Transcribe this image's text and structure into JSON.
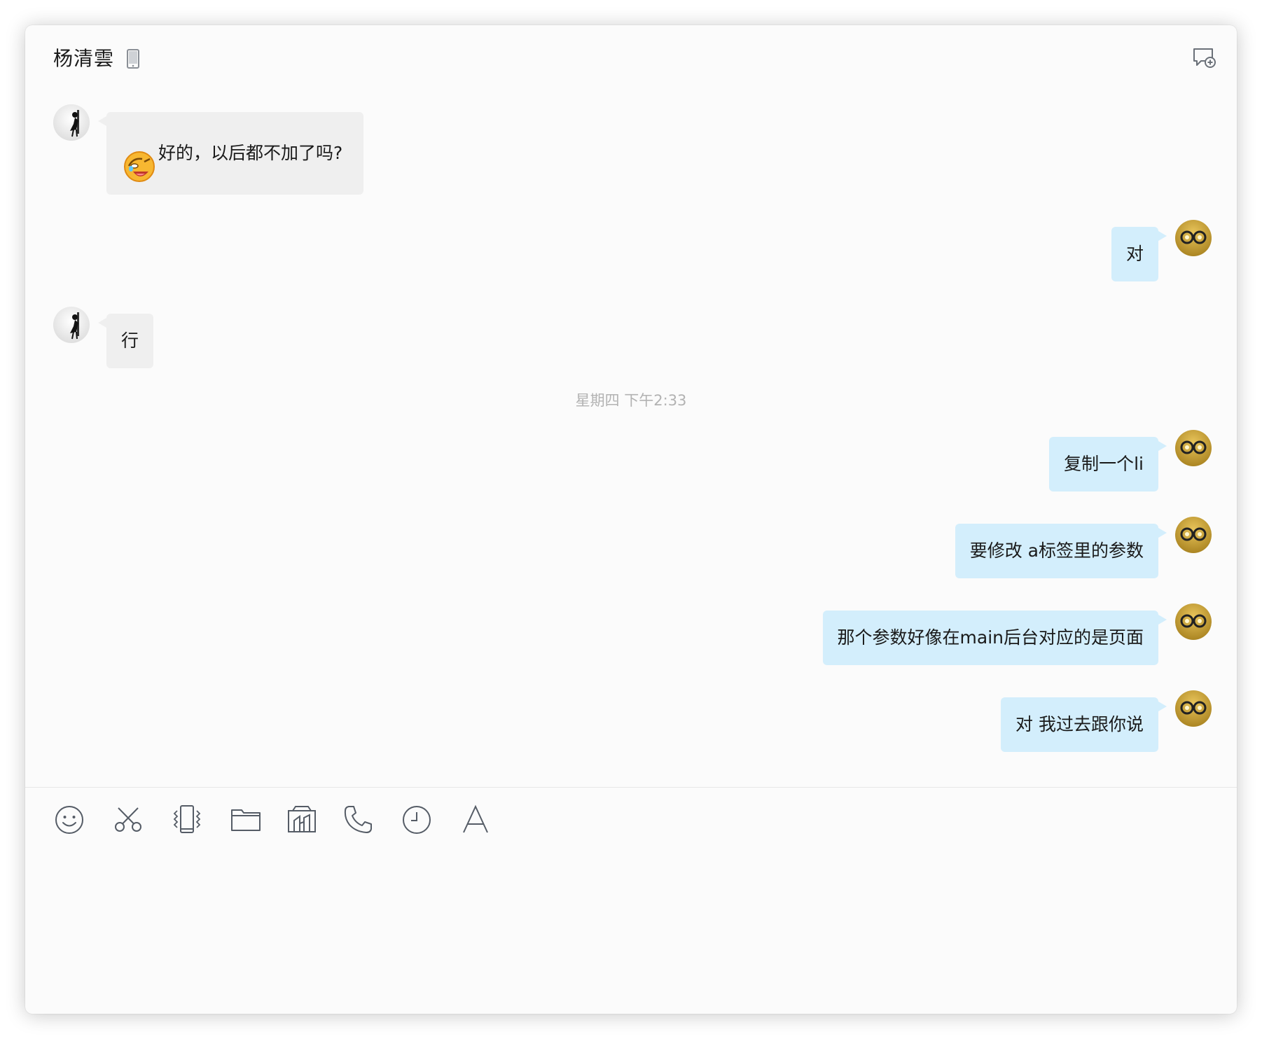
{
  "header": {
    "contact_name": "杨清雲",
    "device_icon": "mobile-phone-icon",
    "new_chat_icon": "chat-add-icon"
  },
  "colors": {
    "incoming_bubble": "#efefef",
    "outgoing_bubble": "#d3eefc",
    "timestamp_text": "#b2b2b2",
    "window_background": "#fbfbfb",
    "icon_stroke": "#555c66"
  },
  "messages": [
    {
      "side": "incoming",
      "emoji": "crying-laughing-emoji",
      "text": "好的，以后都不加了吗?"
    },
    {
      "side": "outgoing",
      "text": "对"
    },
    {
      "side": "incoming",
      "text": "行"
    },
    {
      "side": "outgoing",
      "text": "复制一个li"
    },
    {
      "side": "outgoing",
      "text": "要修改 a标签里的参数"
    },
    {
      "side": "outgoing",
      "text": "那个参数好像在main后台对应的是页面"
    },
    {
      "side": "outgoing",
      "text": "对 我过去跟你说"
    }
  ],
  "timestamp": "星期四  下午2:33",
  "toolbar": {
    "items": [
      {
        "name": "emoji-icon"
      },
      {
        "name": "scissors-icon"
      },
      {
        "name": "shake-phone-icon"
      },
      {
        "name": "folder-icon"
      },
      {
        "name": "screen-share-icon"
      },
      {
        "name": "phone-icon"
      },
      {
        "name": "clock-icon"
      },
      {
        "name": "font-icon"
      }
    ]
  },
  "input": {
    "value": ""
  }
}
